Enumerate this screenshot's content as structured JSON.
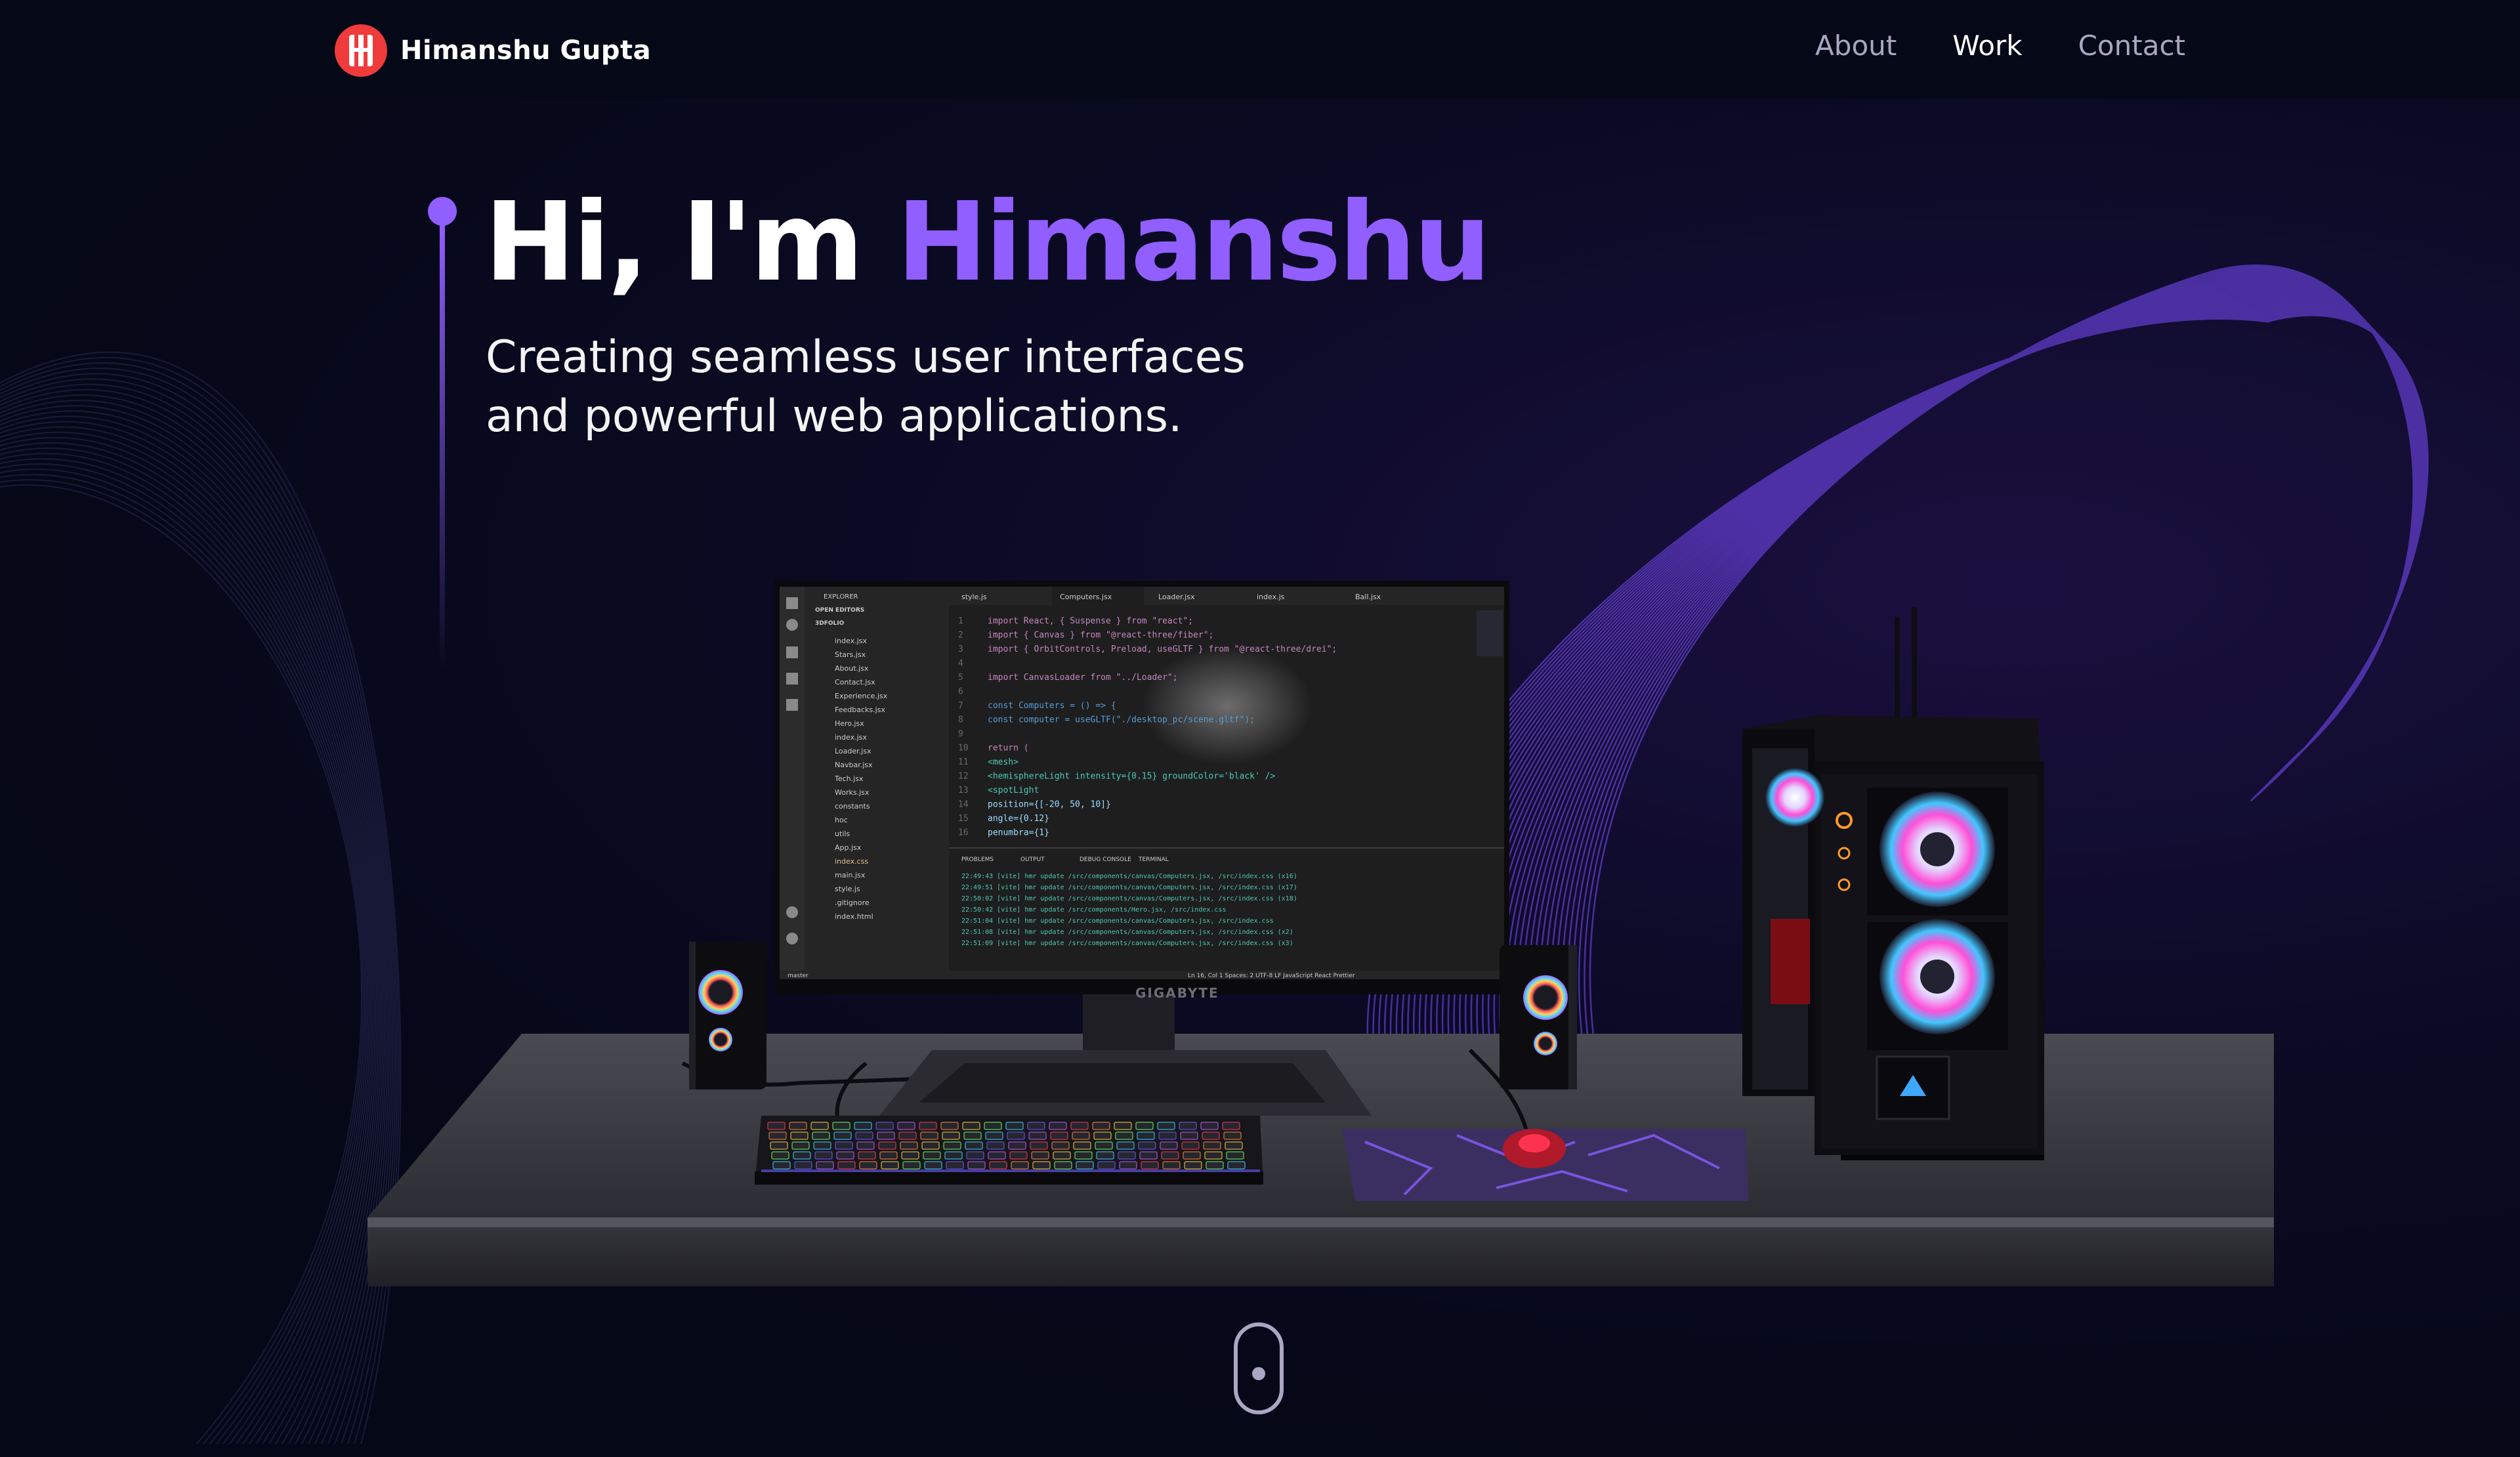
{
  "brand": {
    "name": "Himanshu Gupta",
    "logo_icon": "logo-h-badge",
    "logo_color": "#ef3b3b"
  },
  "nav": {
    "links": [
      {
        "label": "About",
        "active": false
      },
      {
        "label": "Work",
        "active": true
      },
      {
        "label": "Contact",
        "active": false
      }
    ]
  },
  "hero": {
    "title_prefix": "Hi, I'm ",
    "title_name": "Himanshu",
    "subtitle_line1": "Creating seamless user interfaces",
    "subtitle_line2": "and powerful web applications.",
    "accent_color": "#915eff"
  },
  "scene": {
    "monitor_brand": "GIGABYTE",
    "editor": {
      "tabs": [
        "style.js",
        "Computers.jsx",
        "Loader.jsx",
        "index.js",
        "Ball.jsx"
      ],
      "explorer_files": [
        "index.jsx",
        "Stars.jsx",
        "About.jsx",
        "Contact.jsx",
        "Experience.jsx",
        "Feedbacks.jsx",
        "Hero.jsx",
        "index.jsx",
        "Loader.jsx",
        "Navbar.jsx",
        "Tech.jsx",
        "Works.jsx",
        "constants",
        "hoc",
        "utils",
        "App.jsx",
        "index.css",
        "main.jsx",
        "style.js",
        ".gitignore",
        "index.html"
      ],
      "code_lines": [
        "import React, { Suspense } from \"react\";",
        "import { Canvas } from \"@react-three/fiber\";",
        "import { OrbitControls, Preload, useGLTF } from \"@react-three/drei\";",
        "",
        "import CanvasLoader from \"../Loader\";",
        "",
        "const Computers = () => {",
        "  const computer = useGLTF(\"./desktop_pc/scene.gltf\");",
        "",
        "  return (",
        "    <mesh>",
        "      <hemisphereLight intensity={0.15} groundColor='black' />",
        "      <spotLight",
        "        position={[-20, 50, 10]}",
        "        angle={0.12}",
        "        penumbra={1}"
      ],
      "terminal_tabs": [
        "PROBLEMS",
        "OUTPUT",
        "DEBUG CONSOLE",
        "TERMINAL"
      ],
      "terminal_lines": [
        "22:49:43 [vite] hmr update /src/components/canvas/Computers.jsx, /src/index.css (x16)",
        "22:49:51 [vite] hmr update /src/components/canvas/Computers.jsx, /src/index.css (x17)",
        "22:50:02 [vite] hmr update /src/components/canvas/Computers.jsx, /src/index.css (x18)",
        "22:50:42 [vite] hmr update /src/components/Hero.jsx, /src/index.css",
        "22:51:04 [vite] hmr update /src/components/canvas/Computers.jsx, /src/index.css",
        "22:51:08 [vite] hmr update /src/components/canvas/Computers.jsx, /src/index.css (x2)",
        "22:51:09 [vite] hmr update /src/components/canvas/Computers.jsx, /src/index.css (x3)"
      ],
      "status_bar": "Ln 16, Col 1   Spaces: 2   UTF-8   LF   JavaScript React   Prettier"
    }
  },
  "scroll_indicator": {
    "icon": "mouse-scroll-icon"
  }
}
